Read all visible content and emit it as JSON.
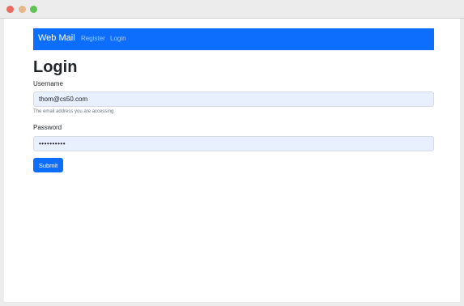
{
  "window": {
    "controls": [
      "close-dot",
      "minimize-dot",
      "maximize-dot"
    ]
  },
  "navbar": {
    "brand": "Web Mail",
    "links": [
      {
        "label": "Register"
      },
      {
        "label": "Login"
      }
    ],
    "color": "#0d6efd"
  },
  "form": {
    "title": "Login",
    "username": {
      "label": "Username",
      "value": "thom@cs50.com",
      "help": "The email address you are accessing"
    },
    "password": {
      "label": "Password",
      "value": "••••••••••"
    },
    "submit_label": "Submit"
  }
}
